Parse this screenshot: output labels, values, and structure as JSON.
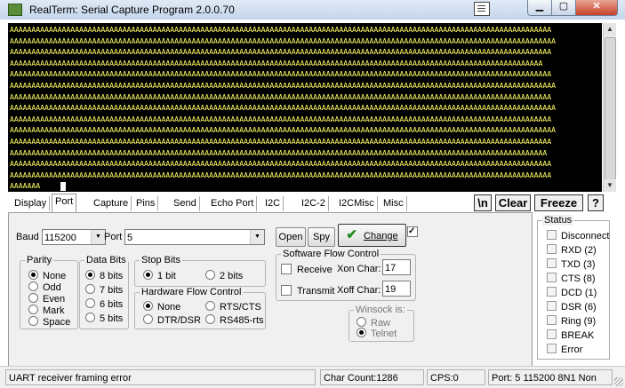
{
  "window": {
    "title": "RealTerm: Serial Capture Program 2.0.0.70"
  },
  "terminal": {
    "lines": [
      "AAAAAAAAAAAAAAAAAAAAAAAAAAAAAAAAAAAAAAAAAAAAAAAAAAAAAAAAAAAAAAAAAAAAAAAAAAAAAAAAAAAAAAAAAAAAAAAAAAAAAAAAAAAAAAAAAAAAAAAAAAAAA",
      "AAAAAAAAAAAAAAAAAAAAAAAAAAAAAAAAAAAAAAAAAAAAAAAAAAAAAAAAAAAAAAAAAAAAAAAAAAAAAAAAAAAAAAAAAAAAAAAAAAAAAAAAAAAAAAAAAAAAAAAAAAAAAA",
      "AAAAAAAAAAAAAAAAAAAAAAAAAAAAAAAAAAAAAAAAAAAAAAAAAAAAAAAAAAAAAAAAAAAAAAAAAAAAAAAAAAAAAAAAAAAAAAAAAAAAAAAAAAAAAAAAAAAAAAAAAAAAA",
      "AAAAAAAAAAAAAAAAAAAAAAAAAAAAAAAAAAAAAAAAAAAAAAAAAAAAAAAAAAAAAAAAAAAAAAAAAAAAAAAAAAAAAAAAAAAAAAAAAAAAAAAAAAAAAAAAAAAAAAAAAAA",
      "AAAAAAAAAAAAAAAAAAAAAAAAAAAAAAAAAAAAAAAAAAAAAAAAAAAAAAAAAAAAAAAAAAAAAAAAAAAAAAAAAAAAAAAAAAAAAAAAAAAAAAAAAAAAAAAAAAAAAAAAAAAAA",
      "AAAAAAAAAAAAAAAAAAAAAAAAAAAAAAAAAAAAAAAAAAAAAAAAAAAAAAAAAAAAAAAAAAAAAAAAAAAAAAAAAAAAAAAAAAAAAAAAAAAAAAAAAAAAAAAAAAAAAAAAAAAAAA",
      "AAAAAAAAAAAAAAAAAAAAAAAAAAAAAAAAAAAAAAAAAAAAAAAAAAAAAAAAAAAAAAAAAAAAAAAAAAAAAAAAAAAAAAAAAAAAAAAAAAAAAAAAAAAAAAAAAAAAAAAAAAAAA",
      "AAAAAAAAAAAAAAAAAAAAAAAAAAAAAAAAAAAAAAAAAAAAAAAAAAAAAAAAAAAAAAAAAAAAAAAAAAAAAAAAAAAAAAAAAAAAAAAAAAAAAAAAAAAAAAAAAAAAAAAAAAAAAA",
      "AAAAAAAAAAAAAAAAAAAAAAAAAAAAAAAAAAAAAAAAAAAAAAAAAAAAAAAAAAAAAAAAAAAAAAAAAAAAAAAAAAAAAAAAAAAAAAAAAAAAAAAAAAAAAAAAAAAAAAAAAAAAA",
      "AAAAAAAAAAAAAAAAAAAAAAAAAAAAAAAAAAAAAAAAAAAAAAAAAAAAAAAAAAAAAAAAAAAAAAAAAAAAAAAAAAAAAAAAAAAAAAAAAAAAAAAAAAAAAAAAAAAAAAAAAAAAAA",
      "AAAAAAAAAAAAAAAAAAAAAAAAAAAAAAAAAAAAAAAAAAAAAAAAAAAAAAAAAAAAAAAAAAAAAAAAAAAAAAAAAAAAAAAAAAAAAAAAAAAAAAAAAAAAAAAAAAAAAAAAAAAAA",
      "AAAAAAAAAAAAAAAAAAAAAAAAAAAAAAAAAAAAAAAAAAAAAAAAAAAAAAAAAAAAAAAAAAAAAAAAAAAAAAAAAAAAAAAAAAAAAAAAAAAAAAAAAAAAAAAAAAAAAAAAAAAA",
      "AAAAAAAAAAAAAAAAAAAAAAAAAAAAAAAAAAAAAAAAAAAAAAAAAAAAAAAAAAAAAAAAAAAAAAAAAAAAAAAAAAAAAAAAAAAAAAAAAAAAAAAAAAAAAAAAAAAAAAAAAAAAA",
      "AAAAAAAAAAAAAAAAAAAAAAAAAAAAAAAAAAAAAAAAAAAAAAAAAAAAAAAAAAAAAAAAAAAAAAAAAAAAAAAAAAAAAAAAAAAAAAAAAAAAAAAAAAAAAAAAAAAAAAAAAAAAA",
      "AAAAAAA"
    ]
  },
  "tabs": [
    "Display",
    "Port",
    "Capture",
    "Pins",
    "Send",
    "Echo Port",
    "I2C",
    "I2C-2",
    "I2CMisc",
    "Misc"
  ],
  "right_buttons": {
    "nl": "\\n",
    "clear": "Clear",
    "freeze": "Freeze",
    "help": "?"
  },
  "port": {
    "baud_label": "Baud",
    "baud_value": "115200",
    "port_label": "Port",
    "port_value": "5",
    "open": "Open",
    "spy": "Spy",
    "change": "Change",
    "parity": {
      "title": "Parity",
      "options": [
        "None",
        "Odd",
        "Even",
        "Mark",
        "Space"
      ]
    },
    "databits": {
      "title": "Data Bits",
      "options": [
        "8 bits",
        "7 bits",
        "6 bits",
        "5 bits"
      ]
    },
    "stopbits": {
      "title": "Stop Bits",
      "opt1": "1 bit",
      "opt2": "2 bits"
    },
    "hwflow": {
      "title": "Hardware Flow Control",
      "none": "None",
      "rtscts": "RTS/CTS",
      "dtrdsr": "DTR/DSR",
      "rs485": "RS485-rts"
    },
    "swflow": {
      "title": "Software Flow Control",
      "receive": "Receive",
      "xon_label": "Xon Char:",
      "xon_value": "17",
      "transmit": "Transmit",
      "xoff_label": "Xoff Char:",
      "xoff_value": "19"
    },
    "winsock": {
      "title": "Winsock is:",
      "raw": "Raw",
      "telnet": "Telnet"
    }
  },
  "status": {
    "title": "Status",
    "items": [
      "Disconnect",
      "RXD (2)",
      "TXD (3)",
      "CTS (8)",
      "DCD (1)",
      "DSR (6)",
      "Ring (9)",
      "BREAK",
      "Error"
    ]
  },
  "statusbar": {
    "message": "UART receiver framing error",
    "char_count": "Char Count:1286",
    "cps": "CPS:0",
    "port_info": "Port: 5 115200 8N1 Non"
  }
}
